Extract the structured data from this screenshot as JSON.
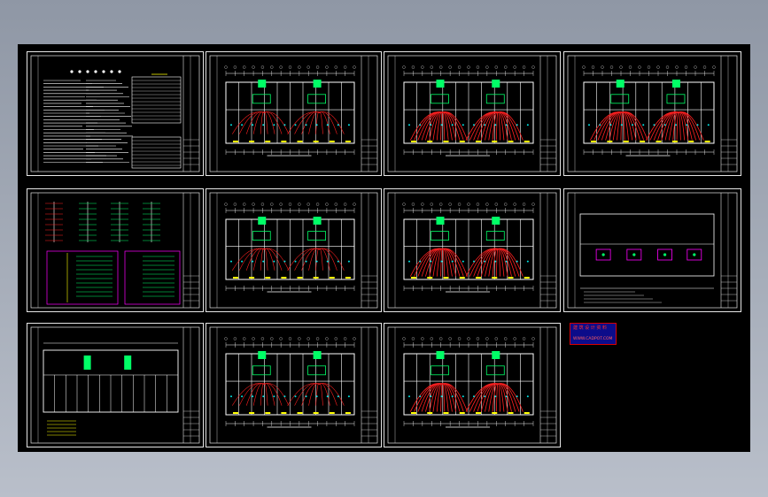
{
  "viewer": {
    "background_top": "#8f97a5",
    "background_bottom": "#b9bfca",
    "modelspace_color": "#000000"
  },
  "sheets": [
    {
      "kind": "notes"
    },
    {
      "kind": "plan-a"
    },
    {
      "kind": "plan-b"
    },
    {
      "kind": "plan-c"
    },
    {
      "kind": "system"
    },
    {
      "kind": "plan-a"
    },
    {
      "kind": "plan-d"
    },
    {
      "kind": "roof"
    },
    {
      "kind": "base"
    },
    {
      "kind": "plan-a"
    },
    {
      "kind": "plan-d"
    }
  ],
  "stamp": {
    "line1": "建 筑 设 计 资 料",
    "line2": "WWW.CADPOT.COM",
    "colors": {
      "fill": "#0c0c8a",
      "border": "#d80000",
      "text": "#ff3030"
    }
  },
  "colors": {
    "frame": "#e6e6e6",
    "wall": "#ffffff",
    "room": "#00ff66",
    "wire": "#ff2020",
    "note": "#ffff00",
    "panel": "#ff00ff",
    "axis": "#00e5e5"
  }
}
